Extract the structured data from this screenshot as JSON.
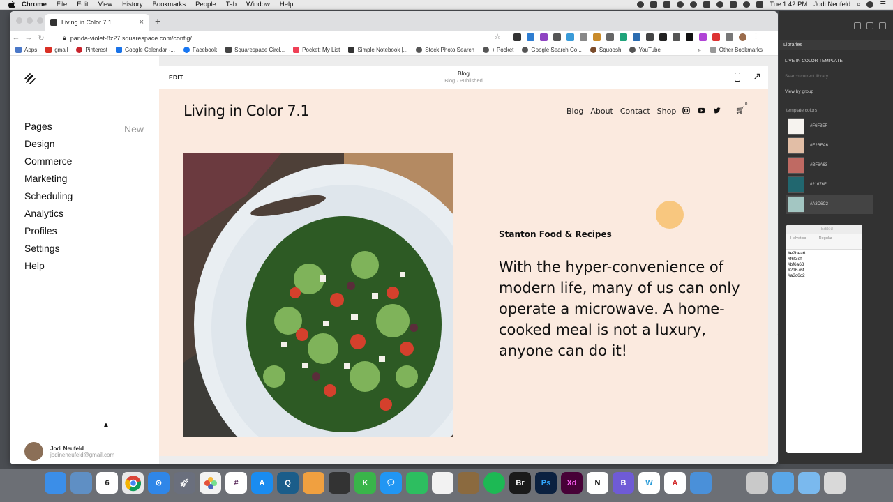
{
  "menubar": {
    "items": [
      "Chrome",
      "File",
      "Edit",
      "View",
      "History",
      "Bookmarks",
      "People",
      "Tab",
      "Window",
      "Help"
    ],
    "clock": "Tue 1:42 PM",
    "user": "Jodi Neufeld"
  },
  "browser": {
    "tab_title": "Living in Color 7.1",
    "url": "panda-violet-8z27.squarespace.com/config/",
    "bookmarks": [
      "Apps",
      "gmail",
      "Pinterest",
      "Google Calendar -...",
      "Facebook",
      "Squarespace Circl...",
      "Pocket: My List",
      "Simple Notebook |...",
      "Stock Photo Search",
      "+ Pocket",
      "Google Search Co...",
      "Squoosh",
      "YouTube"
    ],
    "bookmarks_more": "»",
    "other_bookmarks": "Other Bookmarks"
  },
  "squarespace": {
    "nav": [
      "Pages",
      "Design",
      "Commerce",
      "Marketing",
      "Scheduling",
      "Analytics",
      "Profiles",
      "Settings",
      "Help"
    ],
    "new_badge": "New",
    "user_name": "Jodi Neufeld",
    "user_email": "jodineneufeld@gmail.com"
  },
  "editor": {
    "edit_label": "EDIT",
    "page_title": "Blog",
    "page_status": "Blog · Published"
  },
  "site": {
    "title": "Living in Color 7.1",
    "nav": [
      "Blog",
      "About",
      "Contact",
      "Shop"
    ],
    "cart_count": "0",
    "post_category": "Stanton Food & Recipes",
    "post_text": "With the hyper-convenience of modern life, many of us can only operate a microwave. A home-cooked meal is not a luxury, anyone can do it!"
  },
  "libraries": {
    "panel_title": "Libraries",
    "library_name": "LIVE IN COLOR TEMPLATE",
    "search_placeholder": "Search current library",
    "view_by": "View by group",
    "group_title": "template colors",
    "swatches": [
      {
        "label": "#F6F3EF",
        "color": "#f6f3ef"
      },
      {
        "label": "#E2BEA6",
        "color": "#e2bea6"
      },
      {
        "label": "#BF6A63",
        "color": "#bf6a63"
      },
      {
        "label": "#21676F",
        "color": "#21676f"
      },
      {
        "label": "#A3C6C2",
        "color": "#a3c6c2"
      }
    ]
  },
  "textedit": {
    "title": "— Edited",
    "font": "Helvetica",
    "style": "Regular",
    "lines": [
      "#e2bea6",
      "#f6f3ef",
      "#bf6a63",
      "#21676f",
      "#a3c6c2"
    ]
  },
  "dock": {
    "calendar_day": "6",
    "bridge_label": "Br",
    "ps_label": "Ps",
    "xd_label": "Xd",
    "notion_label": "N",
    "bbedit_label": "B",
    "webflow_label": "W"
  },
  "colors": {
    "site_bg": "#fbeadf",
    "accent_circle": "#f8c77f"
  }
}
